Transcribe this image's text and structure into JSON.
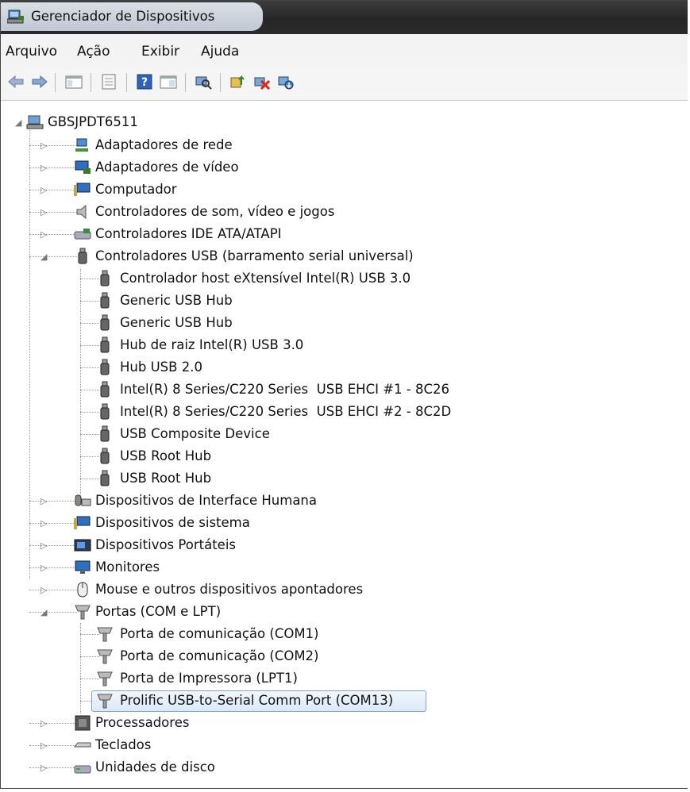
{
  "window": {
    "title": "Gerenciador de Dispositivos"
  },
  "menu": {
    "arquivo": "Arquivo",
    "acao": "Ação",
    "exibir": "Exibir",
    "ajuda": "Ajuda"
  },
  "toolbar": {
    "icons": [
      "back-arrow-icon",
      "forward-arrow-icon",
      "console-tree-icon",
      "properties-icon",
      "help-icon",
      "action-pane-icon",
      "scan-hardware-icon",
      "update-driver-icon",
      "uninstall-icon",
      "disable-device-icon"
    ]
  },
  "tree": {
    "root": "GBSJPDT6511",
    "categories": {
      "rede": "Adaptadores de rede",
      "video": "Adaptadores de vídeo",
      "computador": "Computador",
      "som": "Controladores de som, vídeo e jogos",
      "ide": "Controladores IDE ATA/ATAPI",
      "usb": "Controladores USB (barramento serial universal)",
      "interface": "Dispositivos de Interface Humana",
      "sistema": "Dispositivos de sistema",
      "portateis": "Dispositivos Portáteis",
      "monitores": "Monitores",
      "mouse": "Mouse e outros dispositivos apontadores",
      "portas": "Portas (COM e LPT)",
      "processadores": "Processadores",
      "teclados": "Teclados",
      "disco": "Unidades de disco"
    },
    "usb_children": [
      "Controlador host eXtensível Intel(R) USB 3.0",
      "Generic USB Hub",
      "Generic USB Hub",
      "Hub de raiz Intel(R) USB 3.0",
      "Hub USB 2.0",
      "Intel(R) 8 Series/C220 Series  USB EHCI #1 - 8C26",
      "Intel(R) 8 Series/C220 Series  USB EHCI #2 - 8C2D",
      "USB Composite Device",
      "USB Root Hub",
      "USB Root Hub"
    ],
    "port_children": [
      "Porta de comunicação (COM1)",
      "Porta de comunicação (COM2)",
      "Porta de Impressora (LPT1)",
      "Prolific USB-to-Serial Comm Port (COM13)"
    ],
    "selected": "Prolific USB-to-Serial Comm Port (COM13)"
  }
}
